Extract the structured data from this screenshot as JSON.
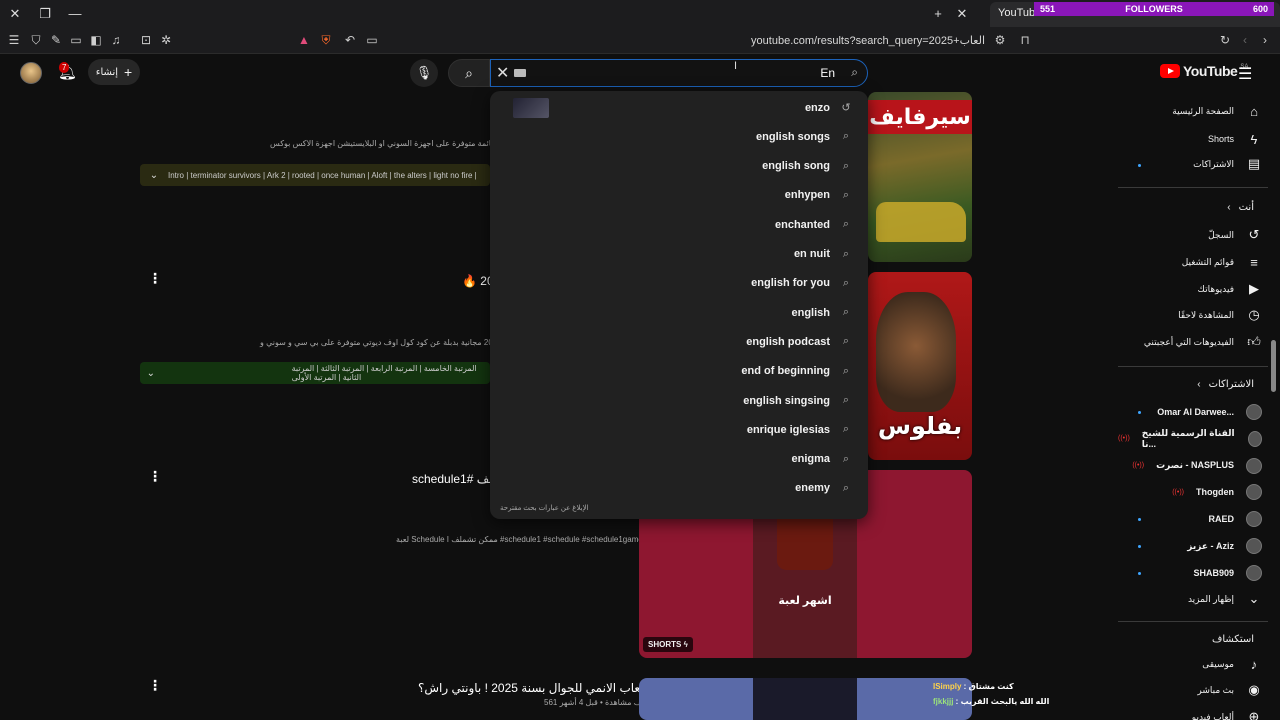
{
  "browser": {
    "tab_title": "YouTube",
    "followers_count": "551",
    "followers_label": "FOLLOWERS",
    "followers_goal": "600",
    "url": "youtube.com/results?search_query=2025+العاب"
  },
  "header": {
    "create_label": "إنشاء",
    "notif_count": "7",
    "search_value": "En",
    "logo_text": "YouTube",
    "logo_region": "SA"
  },
  "suggestions": [
    {
      "text": "enzo",
      "icon": "history-icon"
    },
    {
      "text": "english songs",
      "icon": "search-icon"
    },
    {
      "text": "english song",
      "icon": "search-icon"
    },
    {
      "text": "enhypen",
      "icon": "search-icon"
    },
    {
      "text": "enchanted",
      "icon": "search-icon"
    },
    {
      "text": "en nuit",
      "icon": "search-icon"
    },
    {
      "text": "english for you",
      "icon": "search-icon"
    },
    {
      "text": "english",
      "icon": "search-icon"
    },
    {
      "text": "english podcast",
      "icon": "search-icon"
    },
    {
      "text": "end of beginning",
      "icon": "search-icon"
    },
    {
      "text": "english singsing",
      "icon": "search-icon"
    },
    {
      "text": "enrique iglesias",
      "icon": "search-icon"
    },
    {
      "text": "enigma",
      "icon": "search-icon"
    },
    {
      "text": "enemy",
      "icon": "search-icon"
    }
  ],
  "suggestions_report": "الإبلاغ عن عبارات بحث مقترحة",
  "results": {
    "r1_desc": "الألعاب اللي في القائمة متوفرة على اجهزة السوني او البلايستيشن اجهزة الاكس بوكس ...",
    "r1_chapters": "Intro | terminator survivors | Ark 2 | rooted | once human | Aloft | the alters | light no fire |",
    "r2_title": "🔥 20",
    "r2_desc": "مجانية في 2025 مجانية بدبلة عن كود كول اوف ديوتي متوفرة على بي سي و سوني و ...",
    "r2_chapters": "المرتبة الخامسة | المرتبة الرابعة | المرتبة الثالثة | المرتبة الثانية | المرتبة الأولى",
    "r3_title": "schedule1# ـف",
    "r3_desc": "لعبة Schedule I ممكن تشملف #schedule1 #schedule #schedule1game.",
    "r4_title": "افضل العاب الانمي للجوال بسنة 2025 ! باونتي راش؟",
    "r4_meta": "561 ألف مشاهدة • قبل 4 أشهر",
    "thumb1_text": "سيرفايف",
    "thumb2_text": "بفلوس",
    "thumb3_caption": "اشهر لعبة",
    "shorts_badge": "SHORTS"
  },
  "sidebar": {
    "home": "الصفحة الرئيسية",
    "shorts": "Shorts",
    "subscriptions": "الاشتراكات",
    "you_header": "أنت",
    "history": "السجلّ",
    "playlists": "قوائم التشغيل",
    "your_videos": "فيديوهاتك",
    "watch_later": "المشاهدة لاحقًا",
    "liked": "الفيديوهات التي أعجبتني",
    "subs_header": "الاشتراكات",
    "subs": [
      {
        "name": "Omar Al Darwee...",
        "live": false
      },
      {
        "name": "القناة الرسمية للشيخ نا...",
        "live": true
      },
      {
        "name": "نصرت - NASPLUS",
        "live": true
      },
      {
        "name": "Thogden",
        "live": true
      },
      {
        "name": "RAED",
        "live": false
      },
      {
        "name": "عزيز - Aziz",
        "live": false
      },
      {
        "name": "SHAB909",
        "live": false
      }
    ],
    "show_more": "إظهار المزيد",
    "explore_header": "استكشاف",
    "music": "موسيقى",
    "live": "بث مباشر",
    "gaming": "ألعاب فيديو"
  },
  "chat": {
    "line1_user": "ISimply",
    "line1_msg": "كنت مشتاق",
    "line2_user": "fjkkjjj",
    "line2_msg": "الله الله يالبحث القريب"
  }
}
